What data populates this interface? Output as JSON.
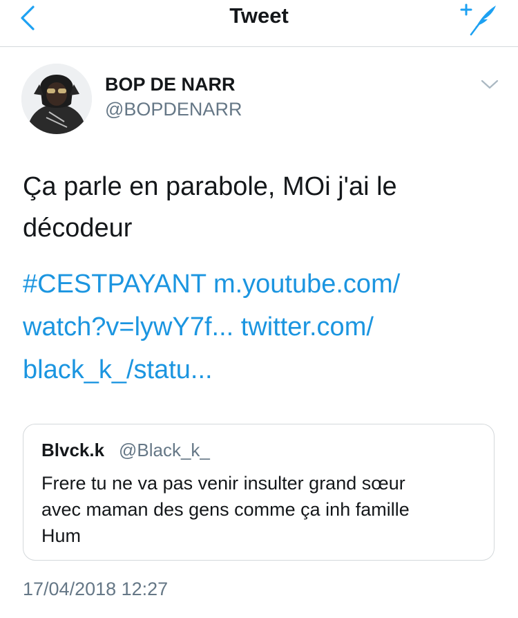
{
  "header": {
    "title": "Tweet",
    "back_icon": "chevron-left-icon",
    "compose_icon": "compose-feather-icon",
    "accent_color": "#1da1f2"
  },
  "tweet": {
    "author": {
      "name": "BOP DE NARR",
      "handle": "@BOPDENARR"
    },
    "text_lines": [
      "Ça parle en parabole, MOi j'ai le",
      "décodeur"
    ],
    "link_lines": [
      [
        "#CESTPAYANT",
        " ",
        "m.youtube.com/"
      ],
      [
        "watch?v=lywY7f...",
        " ",
        "twitter.com/"
      ],
      [
        "black_k_/statu..."
      ]
    ],
    "timestamp": "17/04/2018 12:27"
  },
  "quote": {
    "name": "Blvck.k",
    "handle": "@Black_k_",
    "text_lines": [
      "Frere tu ne va pas venir insulter grand sœur",
      "avec maman des gens comme ça inh famille",
      "Hum"
    ]
  }
}
